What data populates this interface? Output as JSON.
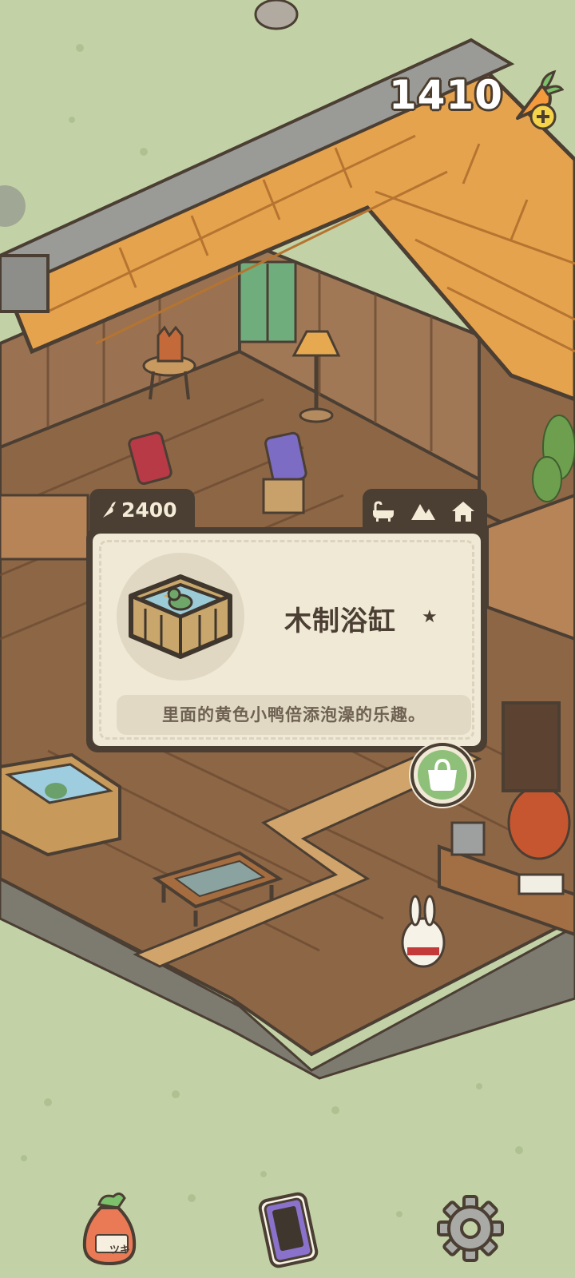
{
  "hud": {
    "carrot_count": "1410",
    "icons": {
      "currency": "carrot-icon",
      "add": "plus-icon"
    }
  },
  "item_panel": {
    "price": "2400",
    "price_icon": "carrot-icon",
    "category_icons": [
      "bathtub-icon",
      "mountain-icon",
      "house-icon"
    ],
    "name": "木制浴缸",
    "star": "★",
    "description": "里面的黄色小鸭倍添泡澡的乐趣。",
    "thumbnail_icon": "wooden-bathtub-icon",
    "buy_icon": "shopping-bag-icon"
  },
  "bottom_bar": {
    "bag_label": "ツキ",
    "icons": [
      "carrot-bag-icon",
      "phone-icon",
      "settings-gear-icon"
    ]
  },
  "colors": {
    "grass": "#c3d2a6",
    "panel_dark": "#4b3e33",
    "panel_light": "#f0e9d6",
    "roof_orange": "#e6a34e",
    "wood_floor": "#8d6645",
    "buy_green": "#8ec07a"
  }
}
